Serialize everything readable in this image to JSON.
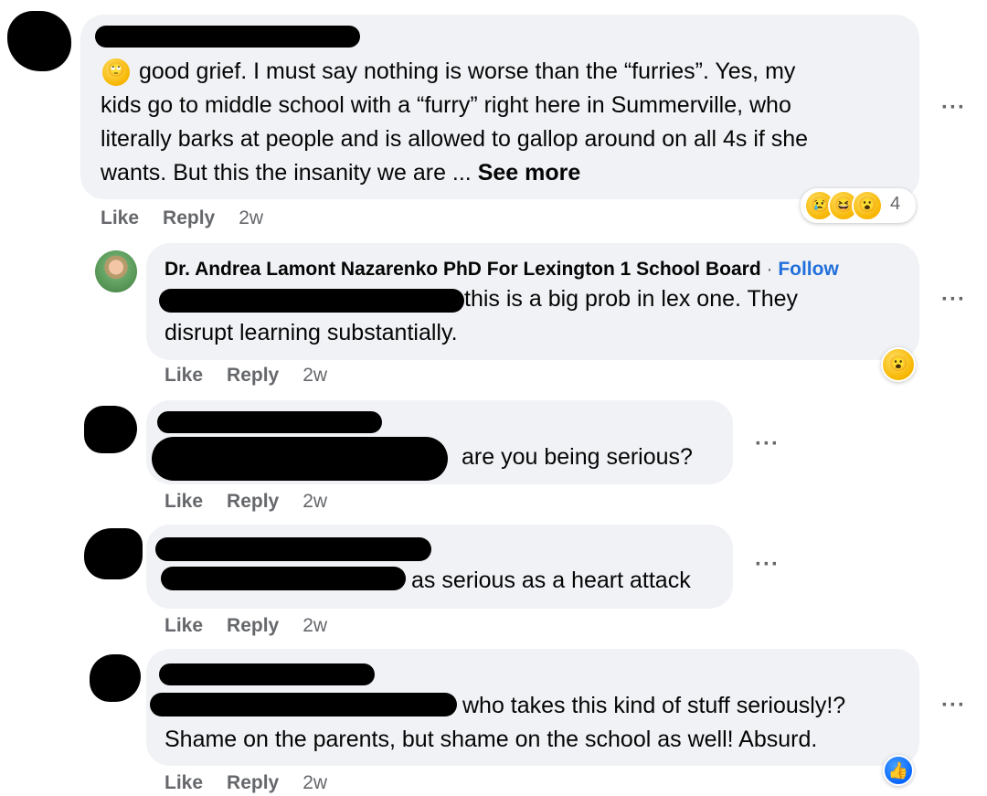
{
  "comments": [
    {
      "author": "",
      "text_lines": [
        "good grief. I must say nothing is worse than the “furries”. Yes, my",
        "kids go to middle school with a “furry” right here in Summerville, who",
        "literally barks at people and is allowed to gallop around on all 4s if she",
        "wants. But this the insanity we are ... "
      ],
      "see_more": "See more",
      "leading_emoji": "🙄",
      "reactions": {
        "icons": [
          "😢",
          "😆",
          "😮"
        ],
        "count": "4"
      },
      "actions": {
        "like": "Like",
        "reply": "Reply",
        "time": "2w"
      }
    },
    {
      "author": "Dr. Andrea Lamont Nazarenko PhD For Lexington 1 School Board",
      "separator": " · ",
      "follow": "Follow",
      "text_lines": [
        "this is a big prob in lex one. They",
        "disrupt learning substantially."
      ],
      "reactions": {
        "icons": [
          "😮"
        ]
      },
      "actions": {
        "like": "Like",
        "reply": "Reply",
        "time": "2w"
      }
    },
    {
      "author": "",
      "text_lines": [
        "are you being serious?"
      ],
      "actions": {
        "like": "Like",
        "reply": "Reply",
        "time": "2w"
      }
    },
    {
      "author": "",
      "text_lines": [
        "as serious as a heart attack"
      ],
      "actions": {
        "like": "Like",
        "reply": "Reply",
        "time": "2w"
      }
    },
    {
      "author": "",
      "text_lines": [
        "who takes this kind of stuff seriously!?",
        "Shame on the parents, but shame on the school as well! Absurd."
      ],
      "reactions": {
        "icons": [
          "👍"
        ]
      },
      "actions": {
        "like": "Like",
        "reply": "Reply",
        "time": "2w"
      }
    }
  ],
  "more_menu_label": "···",
  "colors": {
    "bubble": "#f0f2f5",
    "link": "#216fdb",
    "meta": "#65676b",
    "text": "#050505"
  }
}
